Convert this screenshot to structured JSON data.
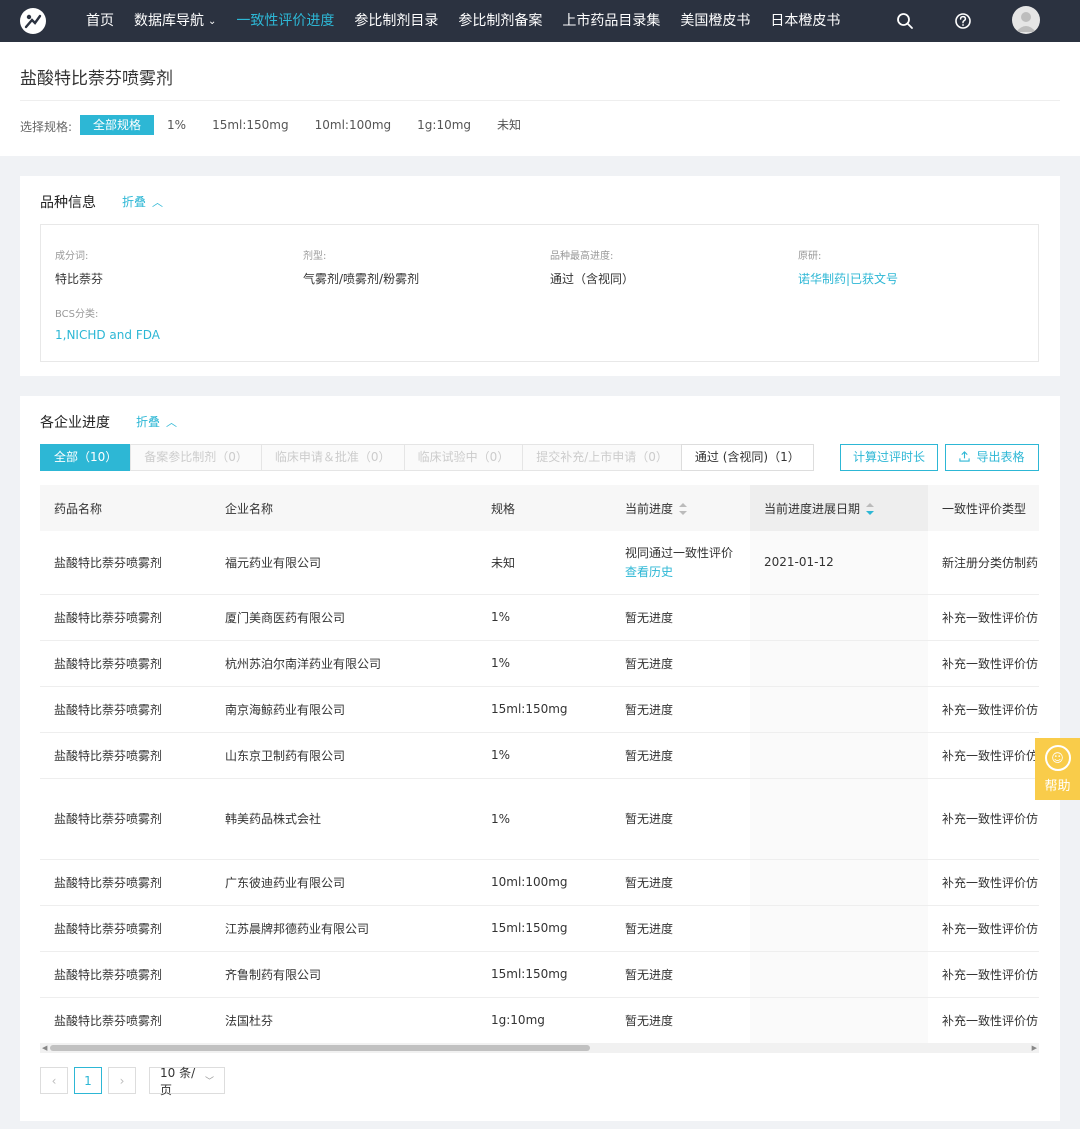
{
  "nav": {
    "items": [
      {
        "label": "首页",
        "active": false,
        "dropdown": false
      },
      {
        "label": "数据库导航",
        "active": false,
        "dropdown": true
      },
      {
        "label": "一致性评价进度",
        "active": true,
        "dropdown": false
      },
      {
        "label": "参比制剂目录",
        "active": false,
        "dropdown": false
      },
      {
        "label": "参比制剂备案",
        "active": false,
        "dropdown": false
      },
      {
        "label": "上市药品目录集",
        "active": false,
        "dropdown": false
      },
      {
        "label": "美国橙皮书",
        "active": false,
        "dropdown": false
      },
      {
        "label": "日本橙皮书",
        "active": false,
        "dropdown": false
      }
    ],
    "icons": [
      "search-icon",
      "help-icon",
      "avatar"
    ],
    "accent_color": "#2db7d5",
    "bg_color": "#2b3240"
  },
  "header": {
    "title": "盐酸特比萘芬喷雾剂",
    "spec_label": "选择规格:",
    "specs": [
      "全部规格",
      "1%",
      "15ml:150mg",
      "10ml:100mg",
      "1g:10mg",
      "未知"
    ],
    "active_spec": "全部规格"
  },
  "variety": {
    "title": "品种信息",
    "fold_label": "折叠",
    "fields": [
      {
        "label": "成分词:",
        "value": "特比萘芬",
        "link": false
      },
      {
        "label": "剂型:",
        "value": "气雾剂/喷雾剂/粉雾剂",
        "link": false
      },
      {
        "label": "品种最高进度:",
        "value": "通过（含视同）",
        "link": false
      },
      {
        "label": "原研:",
        "value": "诺华制药|已获文号",
        "link": true
      },
      {
        "label": "BCS分类:",
        "value": "1,NICHD and FDA",
        "link": true
      }
    ]
  },
  "progress": {
    "title": "各企业进度",
    "fold_label": "折叠",
    "tabs": [
      {
        "label": "全部（10）",
        "state": "active"
      },
      {
        "label": "备案参比制剂（0）",
        "state": "disabled"
      },
      {
        "label": "临床申请＆批准（0）",
        "state": "disabled"
      },
      {
        "label": "临床试验中（0）",
        "state": "disabled"
      },
      {
        "label": "提交补充/上市申请（0）",
        "state": "disabled"
      },
      {
        "label": "通过 (含视同)（1）",
        "state": "normal"
      }
    ],
    "calc_button": "计算过评时长",
    "export_button": "导出表格",
    "columns": [
      "药品名称",
      "企业名称",
      "规格",
      "当前进度",
      "当前进度进展日期",
      "一致性评价类型"
    ],
    "history_link": "查看历史",
    "rows": [
      {
        "drug": "盐酸特比萘芬喷雾剂",
        "company": "福元药业有限公司",
        "spec": "未知",
        "progress": "视同通过一致性评价",
        "date": "2021-01-12",
        "type": "新注册分类仿制药",
        "history": true
      },
      {
        "drug": "盐酸特比萘芬喷雾剂",
        "company": "厦门美商医药有限公司",
        "spec": "1%",
        "progress": "暂无进度",
        "date": "",
        "type": "补充一致性评价仿",
        "history": false
      },
      {
        "drug": "盐酸特比萘芬喷雾剂",
        "company": "杭州苏泊尔南洋药业有限公司",
        "spec": "1%",
        "progress": "暂无进度",
        "date": "",
        "type": "补充一致性评价仿",
        "history": false
      },
      {
        "drug": "盐酸特比萘芬喷雾剂",
        "company": "南京海鲸药业有限公司",
        "spec": "15ml:150mg",
        "progress": "暂无进度",
        "date": "",
        "type": "补充一致性评价仿",
        "history": false
      },
      {
        "drug": "盐酸特比萘芬喷雾剂",
        "company": "山东京卫制药有限公司",
        "spec": "1%",
        "progress": "暂无进度",
        "date": "",
        "type": "补充一致性评价仿",
        "history": false
      },
      {
        "drug": "盐酸特比萘芬喷雾剂",
        "company": "韩美药品株式会社",
        "spec": "1%",
        "progress": "暂无进度",
        "date": "",
        "type": "补充一致性评价仿",
        "history": false
      },
      {
        "drug": "盐酸特比萘芬喷雾剂",
        "company": "广东彼迪药业有限公司",
        "spec": "10ml:100mg",
        "progress": "暂无进度",
        "date": "",
        "type": "补充一致性评价仿",
        "history": false
      },
      {
        "drug": "盐酸特比萘芬喷雾剂",
        "company": "江苏晨牌邦德药业有限公司",
        "spec": "15ml:150mg",
        "progress": "暂无进度",
        "date": "",
        "type": "补充一致性评价仿",
        "history": false
      },
      {
        "drug": "盐酸特比萘芬喷雾剂",
        "company": "齐鲁制药有限公司",
        "spec": "15ml:150mg",
        "progress": "暂无进度",
        "date": "",
        "type": "补充一致性评价仿",
        "history": false
      },
      {
        "drug": "盐酸特比萘芬喷雾剂",
        "company": "法国杜芬",
        "spec": "1g:10mg",
        "progress": "暂无进度",
        "date": "",
        "type": "补充一致性评价仿",
        "history": false
      }
    ]
  },
  "pagination": {
    "prev": "‹",
    "current_page": "1",
    "next": "›",
    "page_size": "10 条/页"
  },
  "help": {
    "label": "帮助"
  }
}
